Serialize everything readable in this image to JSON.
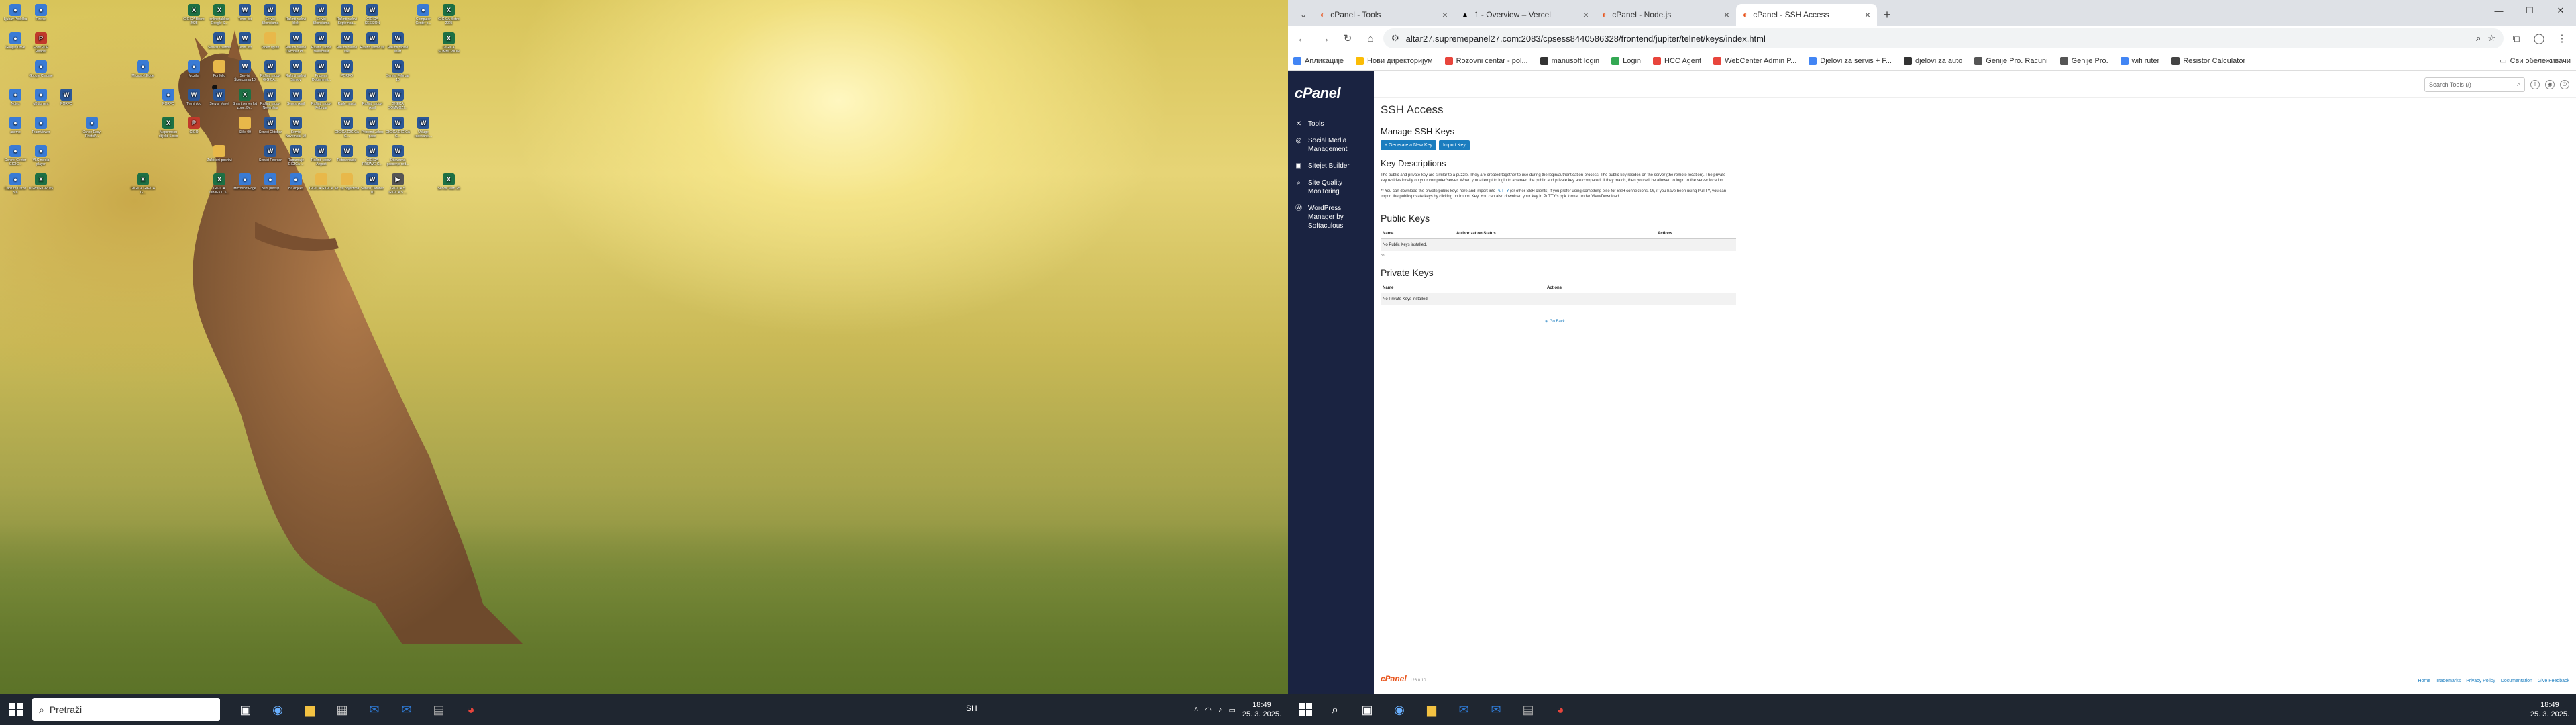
{
  "desktop": {
    "icons": [
      {
        "label": "Ljubav Podrška",
        "type": "app",
        "x": 0,
        "y": 0
      },
      {
        "label": "Firefox",
        "type": "app",
        "x": 1,
        "y": 0
      },
      {
        "label": "GIGICA Bistro 2025",
        "type": "xls",
        "x": 7,
        "y": 0
      },
      {
        "label": "online tablica Google S...",
        "type": "xls",
        "x": 8,
        "y": 0
      },
      {
        "label": "Termi list",
        "type": "doc",
        "x": 9,
        "y": 0
      },
      {
        "label": "Servisi Škonclama",
        "type": "doc",
        "x": 10,
        "y": 0
      },
      {
        "label": "Rašinti radovi blok",
        "type": "doc",
        "x": 11,
        "y": 0
      },
      {
        "label": "Servisi Škonclama",
        "type": "doc",
        "x": 12,
        "y": 0
      },
      {
        "label": "Rašinti radovi Septemba...",
        "type": "doc",
        "x": 13,
        "y": 0
      },
      {
        "label": "GIGICA SESSION",
        "type": "doc",
        "x": 14,
        "y": 0
      },
      {
        "label": "Computer Center s...",
        "type": "app",
        "x": 16,
        "y": 0
      },
      {
        "label": "GIGICA Bistro 2025",
        "type": "xls",
        "x": 17,
        "y": 0
      },
      {
        "label": "Google Drive",
        "type": "app",
        "x": 0,
        "y": 1
      },
      {
        "label": "Foxit PDF Reader",
        "type": "pdf",
        "x": 1,
        "y": 1
      },
      {
        "label": "Servisi Lisanne",
        "type": "doc",
        "x": 8,
        "y": 1
      },
      {
        "label": "Termi list",
        "type": "doc",
        "x": 9,
        "y": 1
      },
      {
        "label": "Video upute",
        "type": "folder",
        "x": 10,
        "y": 1
      },
      {
        "label": "Rašinti radovi Okcobar Pr...",
        "type": "doc",
        "x": 11,
        "y": 1
      },
      {
        "label": "Rašinti radovi Novembar",
        "type": "doc",
        "x": 12,
        "y": 1
      },
      {
        "label": "Rašinti radovi lise",
        "type": "doc",
        "x": 13,
        "y": 1
      },
      {
        "label": "Rašinti radovi lul",
        "type": "doc",
        "x": 14,
        "y": 1
      },
      {
        "label": "Rašinti radovi Mart",
        "type": "doc",
        "x": 15,
        "y": 1
      },
      {
        "label": "GIGICA SOMMOZION",
        "type": "xls",
        "x": 17,
        "y": 1
      },
      {
        "label": "Google Chrome",
        "type": "app",
        "x": 1,
        "y": 2
      },
      {
        "label": "Microsoft Edge",
        "type": "app",
        "x": 5,
        "y": 2
      },
      {
        "label": "Mozilla",
        "type": "app",
        "x": 7,
        "y": 2
      },
      {
        "label": "Portfolio",
        "type": "folder",
        "x": 8,
        "y": 2
      },
      {
        "label": "Servisi Škonclama 10",
        "type": "doc",
        "x": 9,
        "y": 2
      },
      {
        "label": "Rašinti radovi GIGICA...",
        "type": "doc",
        "x": 10,
        "y": 2
      },
      {
        "label": "Rašinti radovi Samov",
        "type": "doc",
        "x": 11,
        "y": 2
      },
      {
        "label": "Pripremi Dokumenti...",
        "type": "doc",
        "x": 12,
        "y": 2
      },
      {
        "label": "PORFO",
        "type": "doc",
        "x": 13,
        "y": 2
      },
      {
        "label": "Servisi Februar 10",
        "type": "doc",
        "x": 15,
        "y": 2
      },
      {
        "label": "Notes",
        "type": "app",
        "x": 0,
        "y": 3
      },
      {
        "label": "qBittorrent",
        "type": "app",
        "x": 1,
        "y": 3
      },
      {
        "label": "PORFO",
        "type": "doc",
        "x": 2,
        "y": 3
      },
      {
        "label": "PORFO",
        "type": "app",
        "x": 6,
        "y": 3
      },
      {
        "label": "Termi doc",
        "type": "doc",
        "x": 7,
        "y": 3
      },
      {
        "label": "Servisi Maret",
        "type": "doc",
        "x": 8,
        "y": 3
      },
      {
        "label": "Smart server list zone, Dr...",
        "type": "xls",
        "x": 9,
        "y": 3
      },
      {
        "label": "Rašinti radovi Novembar",
        "type": "doc",
        "x": 10,
        "y": 3
      },
      {
        "label": "Servisi April",
        "type": "doc",
        "x": 11,
        "y": 3
      },
      {
        "label": "Rašinti radovi Februar",
        "type": "doc",
        "x": 12,
        "y": 3
      },
      {
        "label": "Rade maslo",
        "type": "doc",
        "x": 13,
        "y": 3
      },
      {
        "label": "Rašinti radovi April",
        "type": "doc",
        "x": 14,
        "y": 3
      },
      {
        "label": "GIGICA SOMMOZI...",
        "type": "doc",
        "x": 15,
        "y": 3
      },
      {
        "label": "anemp",
        "type": "app",
        "x": 0,
        "y": 4
      },
      {
        "label": "TeamViewer",
        "type": "app",
        "x": 1,
        "y": 4
      },
      {
        "label": "Canon Easy-PhotoP...",
        "type": "app",
        "x": 3,
        "y": 4
      },
      {
        "label": "Mapcrmsku objekti 5.xlsx",
        "type": "xls",
        "x": 6,
        "y": 4
      },
      {
        "label": "GIGO",
        "type": "pdf",
        "x": 7,
        "y": 4
      },
      {
        "label": "Slike 09",
        "type": "folder",
        "x": 9,
        "y": 4
      },
      {
        "label": "Servisi Oktobar",
        "type": "doc",
        "x": 10,
        "y": 4
      },
      {
        "label": "Servisi Novembar 10",
        "type": "doc",
        "x": 11,
        "y": 4
      },
      {
        "label": "GIGICA GIGICA G...",
        "type": "doc",
        "x": 13,
        "y": 4
      },
      {
        "label": "Pripremi Jakoc pase",
        "type": "doc",
        "x": 14,
        "y": 4
      },
      {
        "label": "GIGICA GIGICA G...",
        "type": "doc",
        "x": 15,
        "y": 4
      },
      {
        "label": "Usluge radovanje...",
        "type": "doc",
        "x": 16,
        "y": 4
      },
      {
        "label": "Control Center GIGIC...",
        "type": "app",
        "x": 0,
        "y": 5
      },
      {
        "label": "VLC media player",
        "type": "app",
        "x": 1,
        "y": 5
      },
      {
        "label": "Zaštićeni posrtivi",
        "type": "folder",
        "x": 8,
        "y": 5
      },
      {
        "label": "Servisi Februar",
        "type": "doc",
        "x": 10,
        "y": 5
      },
      {
        "label": "Rapamalje GIGICA ...",
        "type": "doc",
        "x": 11,
        "y": 5
      },
      {
        "label": "Rašinti radovi Avgust",
        "type": "doc",
        "x": 12,
        "y": 5
      },
      {
        "label": "Petrovinasije",
        "type": "doc",
        "x": 13,
        "y": 5
      },
      {
        "label": "GIGICA PRIJAVE G...",
        "type": "doc",
        "x": 14,
        "y": 5
      },
      {
        "label": "Obavezna gascenje red...",
        "type": "doc",
        "x": 15,
        "y": 5
      },
      {
        "label": "Capture Citron 5.6",
        "type": "app",
        "x": 0,
        "y": 6
      },
      {
        "label": "IsSWI GIGI2025",
        "type": "xls",
        "x": 1,
        "y": 6
      },
      {
        "label": "GIGICA GIGICA G...",
        "type": "xls",
        "x": 5,
        "y": 6
      },
      {
        "label": "GIGICA OBJEKTI 5...",
        "type": "xls",
        "x": 8,
        "y": 6
      },
      {
        "label": "Microsoft Edge",
        "type": "app",
        "x": 9,
        "y": 6
      },
      {
        "label": "Bent pristup",
        "type": "app",
        "x": 10,
        "y": 6
      },
      {
        "label": "Blt objekti",
        "type": "app",
        "x": 11,
        "y": 6
      },
      {
        "label": "GIGICA GIGICA",
        "type": "folder",
        "x": 12,
        "y": 6
      },
      {
        "label": "Alt. sa objektima",
        "type": "folder",
        "x": 13,
        "y": 6
      },
      {
        "label": "Servisi Oktobar 10",
        "type": "doc",
        "x": 14,
        "y": 6
      },
      {
        "label": "GIGICA 5 GIGICA 5 ...",
        "type": "mkv",
        "x": 15,
        "y": 6
      },
      {
        "label": "Servisi Mart 25",
        "type": "xls",
        "x": 17,
        "y": 6
      }
    ]
  },
  "left_taskbar": {
    "search_placeholder": "Pretraži",
    "center_text": "SH",
    "time": "18:49",
    "date": "25. 3. 2025."
  },
  "browser": {
    "tabs": [
      {
        "label": "cPanel - Tools",
        "active": false
      },
      {
        "label": "1 - Overview – Vercel",
        "active": false
      },
      {
        "label": "cPanel - Node.js",
        "active": false
      },
      {
        "label": "cPanel - SSH Access",
        "active": true
      }
    ],
    "url": "altar27.supremepanel27.com:2083/cpsess8440586328/frontend/jupiter/telnet/keys/index.html",
    "bookmarks": [
      "Апликације",
      "Нови директоријум",
      "Rozovni centar - pol...",
      "manusoft login",
      "Login",
      "HCC Agent",
      "WebCenter Admin P...",
      "Djelovi za servis + F...",
      "djelovi za auto",
      "Genije Pro. Racuni",
      "Genije Pro.",
      "wifi ruter",
      "Resistor Calculator"
    ],
    "bookmarks_right": "Сви обележивачи"
  },
  "cpanel": {
    "logo": "cPanel",
    "nav": [
      {
        "label": "Tools",
        "icon": "wrench-icon"
      },
      {
        "label": "Social Media Management",
        "icon": "share-icon"
      },
      {
        "label": "Sitejet Builder",
        "icon": "builder-icon"
      },
      {
        "label": "Site Quality Monitoring",
        "icon": "monitor-icon"
      },
      {
        "label": "WordPress Manager by Softaculous",
        "icon": "wordpress-icon"
      }
    ],
    "search_placeholder": "Search Tools (/)",
    "page_title": "SSH Access",
    "manage_heading": "Manage SSH Keys",
    "generate_btn": "+ Generate a New Key",
    "import_btn": "Import Key",
    "desc_heading": "Key Descriptions",
    "desc_p1": "The public and private key are similar to a puzzle. They are created together to use during the login/authentication process. The public key resides on the server (the remote location). The private key resides locally on your computer/server. When you attempt to login to a server, the public and private key are compared. If they match, then you will be allowed to login to the server location.",
    "desc_p2_a": "** You can download the private/public keys here and import into",
    "desc_p2_link": "PuTTY",
    "desc_p2_b": "(or other SSH clients) if you prefer using something else for SSH connections. Or, if you have been using PuTTY, you can import the public/private keys by clicking on Import Key. You can also download your key in PuTTY's ppk format under View/Download.",
    "public_heading": "Public Keys",
    "public_cols": [
      "Name",
      "Authorization Status",
      "Actions"
    ],
    "public_empty": "No Public Keys installed.",
    "small_text": "on",
    "private_heading": "Private Keys",
    "private_cols": [
      "Name",
      "Actions"
    ],
    "private_empty": "No Private Keys installed.",
    "go_back": "Go Back",
    "footer_logo": "cPanel",
    "footer_version": "126.0.10",
    "footer_links": [
      "Home",
      "Trademarks",
      "Privacy Policy",
      "Documentation",
      "Give Feedback"
    ]
  },
  "right_taskbar": {
    "time": "18:49",
    "date": "25. 3. 2025."
  }
}
